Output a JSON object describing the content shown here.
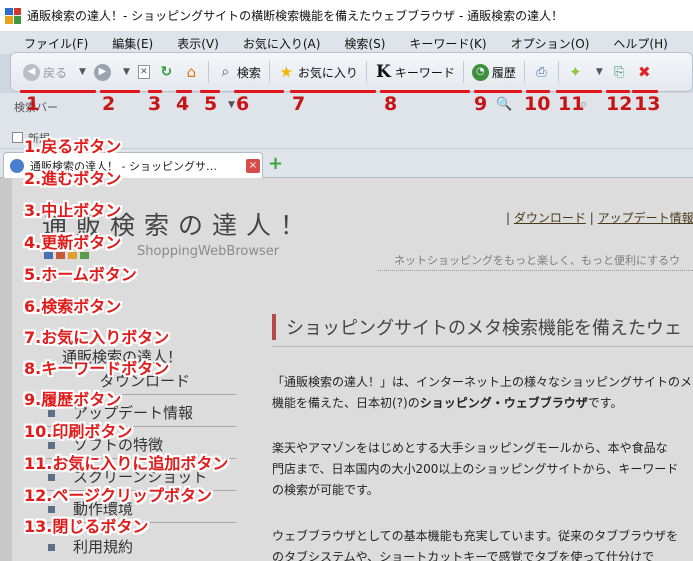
{
  "window": {
    "title": "通販検索の達人！- ショッピングサイトの横断検索機能を備えたウェブブラウザ - 通販検索の達人！"
  },
  "menu": [
    "ファイル(F)",
    "編集(E)",
    "表示(V)",
    "お気に入り(A)",
    "検索(S)",
    "キーワード(K)",
    "オプション(O)",
    "ヘルプ(H)"
  ],
  "toolbar": {
    "back": "戻る",
    "search": "検索",
    "favorites": "お気に入り",
    "keyword": "キーワード",
    "history": "履歴",
    "keyword_icon": "K"
  },
  "numbers": [
    "1",
    "2",
    "3",
    "4",
    "5",
    "6",
    "7",
    "8",
    "9",
    "10",
    "11",
    "12",
    "13"
  ],
  "second_row": {
    "label": "検索バー"
  },
  "bookmark_bar": {
    "label": "新規"
  },
  "tab": {
    "title": "通販検索の達人！ - ショッピングサ…",
    "close": "×",
    "new": "+"
  },
  "page": {
    "logo": "通販検索の達人！",
    "logo_sub": "ShoppingWebBrowser",
    "link_sep": "|",
    "link_download": "ダウンロード",
    "link_update": "アップデート情報",
    "tagline": "ネットショッピングをもっと楽しく、もっと便利にするウ",
    "nav": [
      "通販検索の達人！",
      "ダウンロード",
      "アップデート情報",
      "ソフトの特徴",
      "スクリーンショット",
      "動作環境",
      "利用規約"
    ],
    "heading": "ショッピングサイトのメタ検索機能を備えたウェ",
    "p1_a": "「通販検索の達人！」は、インターネット上の様々なショッピングサイトのメ",
    "p1_b": "機能を備えた、日本初(?)の",
    "p1_bold": "ショッピング・ウェブブラウザ",
    "p1_c": "です。",
    "p2_a": "楽天やアマゾンをはじめとする大手ショッピングモールから、本や食品な",
    "p2_b": "門店まで、日本国内の大小200以上のショッピングサイトから、キーワード",
    "p2_c": "の検索が可能です。",
    "p3_a": "ウェブブラウザとしての基本機能も充実しています。従来のタブブラウザを",
    "p3_b": "のタブシステムや、ショートカットキーで感覚でタブを使って仕分けで"
  },
  "callouts": [
    "1.戻るボタン",
    "2.進むボタン",
    "3.中止ボタン",
    "4.更新ボタン",
    "5.ホームボタン",
    "6.検索ボタン",
    "7.お気に入りボタン",
    "8.キーワードボタン",
    "9.履歴ボタン",
    "10.印刷ボタン",
    "11.お気に入りに追加ボタン",
    "12.ページクリップボタン",
    "13.閉じるボタン"
  ],
  "colors": {
    "callout": "#e11a1a",
    "number": "#c81414",
    "accent_heading": "#b24a4a"
  }
}
